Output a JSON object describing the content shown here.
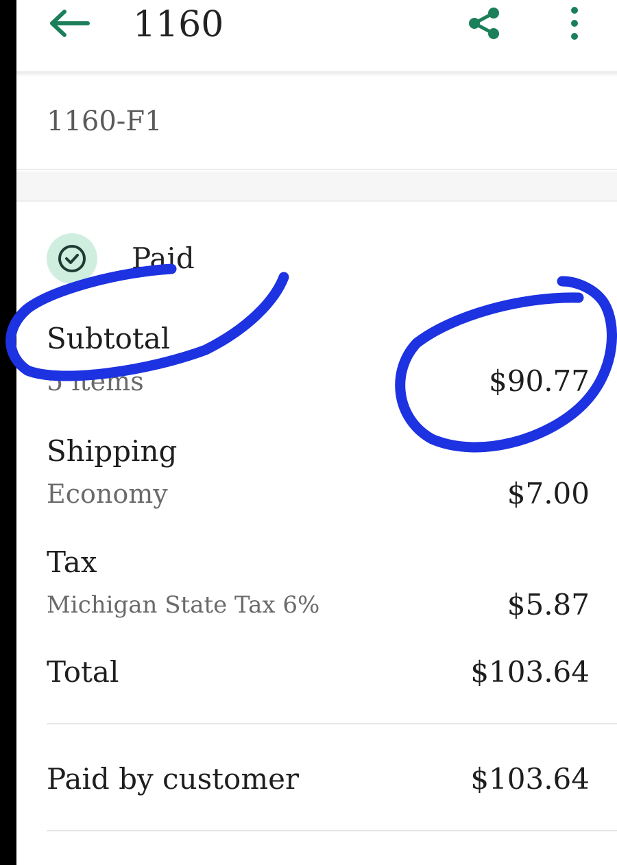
{
  "header": {
    "title": "1160",
    "back_icon": "arrow-left-icon",
    "share_icon": "share-icon",
    "more_icon": "more-vertical-icon",
    "accent_color": "#1b7f5a"
  },
  "order": {
    "number": "1160-F1"
  },
  "status": {
    "label": "Paid",
    "icon": "check-circle-icon",
    "badge_color": "#cfeee0"
  },
  "summary": {
    "subtotal": {
      "label": "Subtotal",
      "sub": "5 items",
      "amount": "$90.77"
    },
    "shipping": {
      "label": "Shipping",
      "sub": "Economy",
      "amount": "$7.00"
    },
    "tax": {
      "label": "Tax",
      "sub": "Michigan State Tax 6%",
      "amount": "$5.87"
    },
    "total": {
      "label": "Total",
      "amount": "$103.64"
    },
    "paid_by_customer": {
      "label": "Paid by customer",
      "amount": "$103.64"
    }
  },
  "annotation": {
    "color": "#1d32e0"
  }
}
